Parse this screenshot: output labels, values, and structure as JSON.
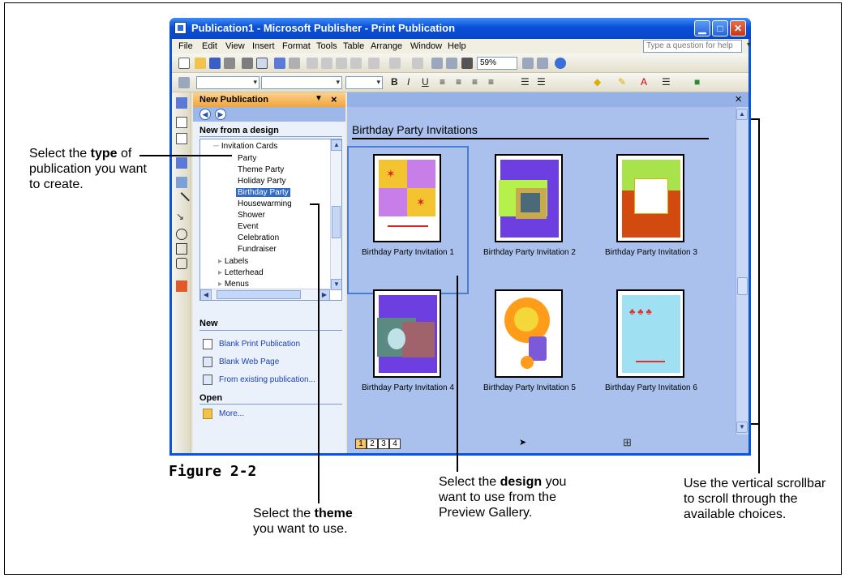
{
  "window": {
    "title": "Publication1 - Microsoft Publisher - Print Publication"
  },
  "menu": {
    "items": [
      "File",
      "Edit",
      "View",
      "Insert",
      "Format",
      "Tools",
      "Table",
      "Arrange",
      "Window",
      "Help"
    ],
    "ask_placeholder": "Type a question for help"
  },
  "toolbar": {
    "zoom": "59%"
  },
  "taskpane": {
    "title": "New Publication",
    "section_design": "New from a design",
    "tree": {
      "category": "Invitation Cards",
      "items": [
        "Party",
        "Theme Party",
        "Holiday Party",
        "Birthday Party",
        "Housewarming",
        "Shower",
        "Event",
        "Celebration",
        "Fundraiser"
      ],
      "selected": "Birthday Party",
      "other": [
        "Labels",
        "Letterhead",
        "Menus"
      ]
    },
    "section_new": "New",
    "new_links": [
      "Blank Print Publication",
      "Blank Web Page",
      "From existing publication..."
    ],
    "section_open": "Open",
    "open_links": [
      "More..."
    ]
  },
  "gallery": {
    "title": "Birthday Party Invitations",
    "thumbnails": [
      "Birthday Party Invitation 1",
      "Birthday Party Invitation 2",
      "Birthday Party Invitation 3",
      "Birthday Party Invitation 4",
      "Birthday Party Invitation 5",
      "Birthday Party Invitation 6"
    ]
  },
  "statusbar": {
    "pages": [
      "1",
      "2",
      "3",
      "4"
    ]
  },
  "figure_label": "Figure 2-2",
  "callouts": {
    "type": {
      "pre": "Select the ",
      "bold": "type",
      "post": " of publication you want to create."
    },
    "theme": {
      "pre": "Select the ",
      "bold": "theme",
      "post": " you want to use."
    },
    "design": {
      "pre": "Select the ",
      "bold": "design",
      "post": " you want to use from the Preview Gallery."
    },
    "scroll": {
      "text": "Use the vertical scrollbar to scroll through the available choices."
    }
  },
  "colors": {
    "titlebar": "#0a4fd8",
    "taskpane_header": "#f1a43b",
    "gallery_bg": "#a9c1ec",
    "selection": "#316ac5"
  }
}
